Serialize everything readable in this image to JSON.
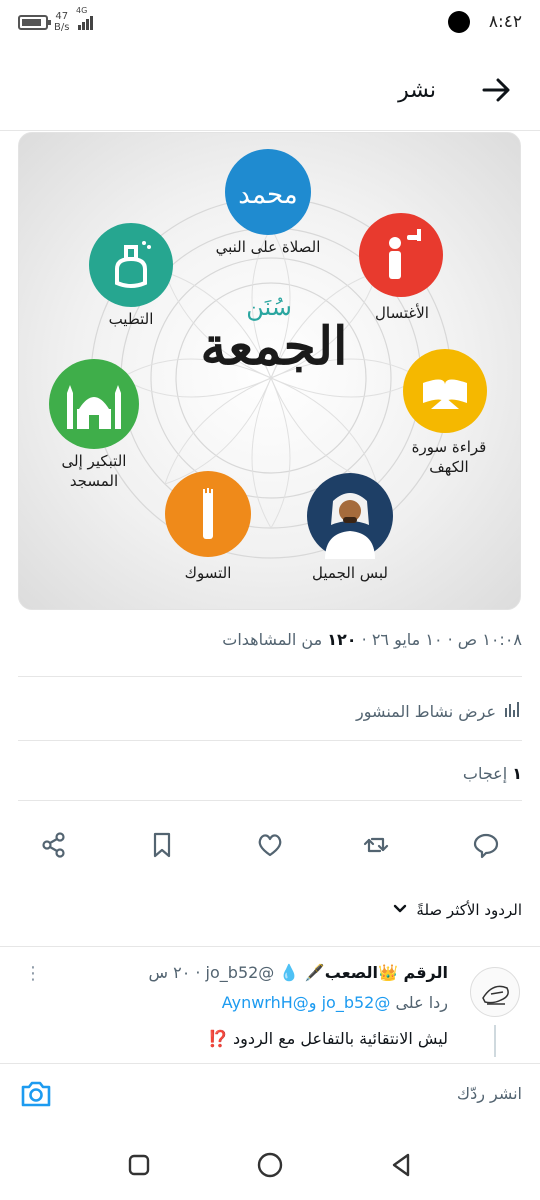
{
  "status_bar": {
    "time": "٨:٤٢",
    "net_speed_value": "47",
    "net_speed_unit": "B/s",
    "network": "4G"
  },
  "header": {
    "title": "نشر",
    "back_icon": "arrow-right-icon"
  },
  "media": {
    "center_small": "سُنَن",
    "center_title": "الجمعة",
    "items": [
      {
        "label": "الصلاة على النبي",
        "color": "#1f8bd0",
        "icon": "calligraphy-icon"
      },
      {
        "label": "الأغتسال",
        "color": "#e83a2e",
        "icon": "shower-icon"
      },
      {
        "label": "قراءة سورة",
        "label2": "الكهف",
        "color": "#f5b800",
        "icon": "quran-icon"
      },
      {
        "label": "لبس الجميل",
        "color": "#1e3f66",
        "icon": "man-icon"
      },
      {
        "label": "التسوك",
        "color": "#ef8a1a",
        "icon": "miswak-icon"
      },
      {
        "label": "التبكير إلى",
        "label2": "المسجد",
        "color": "#3fae4a",
        "icon": "mosque-icon"
      },
      {
        "label": "التطيب",
        "color": "#26a690",
        "icon": "perfume-icon"
      }
    ]
  },
  "tweet_meta": {
    "time": "١٠:٠٨ ص",
    "date": "١٠ مايو ٢٦",
    "views_count": "١٢٠",
    "views_label": "من المشاهدات"
  },
  "activity": {
    "label": "عرض نشاط المنشور",
    "icon": "bar-chart-icon"
  },
  "likes": {
    "count": "١",
    "label": "إعجاب"
  },
  "actions": [
    {
      "name": "reply-icon"
    },
    {
      "name": "retweet-icon"
    },
    {
      "name": "like-icon"
    },
    {
      "name": "bookmark-icon"
    },
    {
      "name": "share-icon"
    }
  ],
  "replies_sort": {
    "label": "الردود الأكثر صلةً"
  },
  "reply": {
    "display_name": "الرقم 👑الصعب🖋️ 💧",
    "handle": "@jo_b52",
    "age": "٢٠ س",
    "reply_to_prefix": "ردا على",
    "reply_to_handles": "@jo_b52 و@AynwrhH",
    "text": "ليش الانتقائية بالتفاعل مع الردود ⁉️"
  },
  "compose": {
    "placeholder": "انشر ردّك"
  },
  "navigation": {
    "buttons": [
      "recent-apps-icon",
      "home-icon",
      "back-icon"
    ]
  }
}
